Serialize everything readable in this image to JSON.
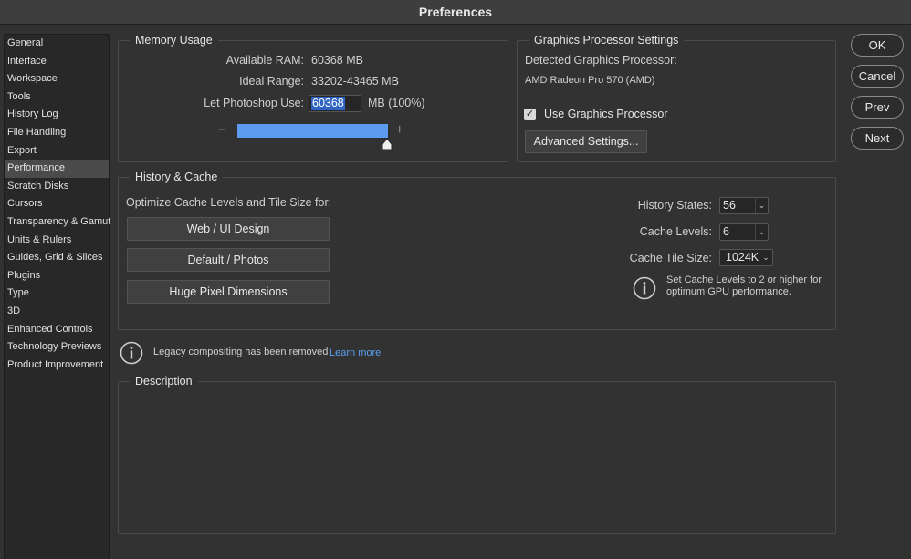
{
  "window": {
    "title": "Preferences"
  },
  "sidebar": {
    "items": [
      {
        "label": "General"
      },
      {
        "label": "Interface"
      },
      {
        "label": "Workspace"
      },
      {
        "label": "Tools"
      },
      {
        "label": "History Log"
      },
      {
        "label": "File Handling"
      },
      {
        "label": "Export"
      },
      {
        "label": "Performance",
        "selected": true
      },
      {
        "label": "Scratch Disks"
      },
      {
        "label": "Cursors"
      },
      {
        "label": "Transparency & Gamut"
      },
      {
        "label": "Units & Rulers"
      },
      {
        "label": "Guides, Grid & Slices"
      },
      {
        "label": "Plugins"
      },
      {
        "label": "Type"
      },
      {
        "label": "3D"
      },
      {
        "label": "Enhanced Controls"
      },
      {
        "label": "Technology Previews"
      },
      {
        "label": "Product Improvement"
      }
    ]
  },
  "memory": {
    "title": "Memory Usage",
    "available_label": "Available RAM:",
    "available_value": "60368 MB",
    "ideal_label": "Ideal Range:",
    "ideal_value": "33202-43465 MB",
    "use_label": "Let Photoshop Use:",
    "use_value": "60368",
    "use_unit": "MB (100%)",
    "minus": "−",
    "plus": "+",
    "slider_fraction": 1.0
  },
  "gpu": {
    "title": "Graphics Processor Settings",
    "detected_label": "Detected Graphics Processor:",
    "detected_value": "AMD Radeon Pro 570 (AMD)",
    "use_gpu_label": "Use Graphics Processor",
    "use_gpu_checked": true,
    "advanced_button": "Advanced Settings..."
  },
  "history_cache": {
    "title": "History & Cache",
    "optimize_label": "Optimize Cache Levels and Tile Size for:",
    "buttons": [
      "Web / UI Design",
      "Default / Photos",
      "Huge Pixel Dimensions"
    ],
    "history_states_label": "History States:",
    "history_states_value": "56",
    "cache_levels_label": "Cache Levels:",
    "cache_levels_value": "6",
    "tile_size_label": "Cache Tile Size:",
    "tile_size_value": "1024K",
    "info_text_1": "Set Cache Levels to 2 or higher for",
    "info_text_2": "optimum GPU performance."
  },
  "legacy": {
    "text": "Legacy compositing has been removed",
    "link": "Learn more"
  },
  "description": {
    "title": "Description"
  },
  "actions": {
    "ok": "OK",
    "cancel": "Cancel",
    "prev": "Prev",
    "next": "Next"
  },
  "colors": {
    "accent": "#5b9cf0",
    "selection": "#2f64c5",
    "link": "#5aa0f0"
  }
}
